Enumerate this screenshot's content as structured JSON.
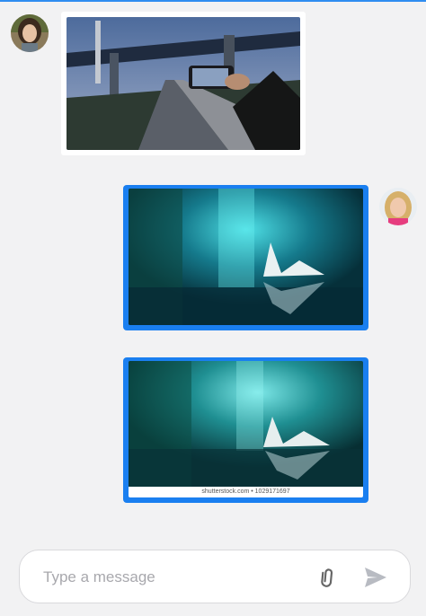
{
  "messages": [
    {
      "side": "received",
      "avatar": "woman-dark-hair-avatar",
      "content": "photo-bridge-road"
    },
    {
      "side": "sent",
      "avatar": "woman-blonde-avatar",
      "content": "photo-leaf-aurora"
    },
    {
      "side": "sent",
      "content": "photo-leaf-aurora-watermarked",
      "watermark": "shutterstock.com • 1029171697"
    }
  ],
  "composer": {
    "placeholder": "Type a message",
    "attach_icon": "paperclip-icon",
    "send_icon": "send-icon"
  },
  "colors": {
    "accent": "#1a7ff0",
    "background": "#f2f2f3"
  }
}
